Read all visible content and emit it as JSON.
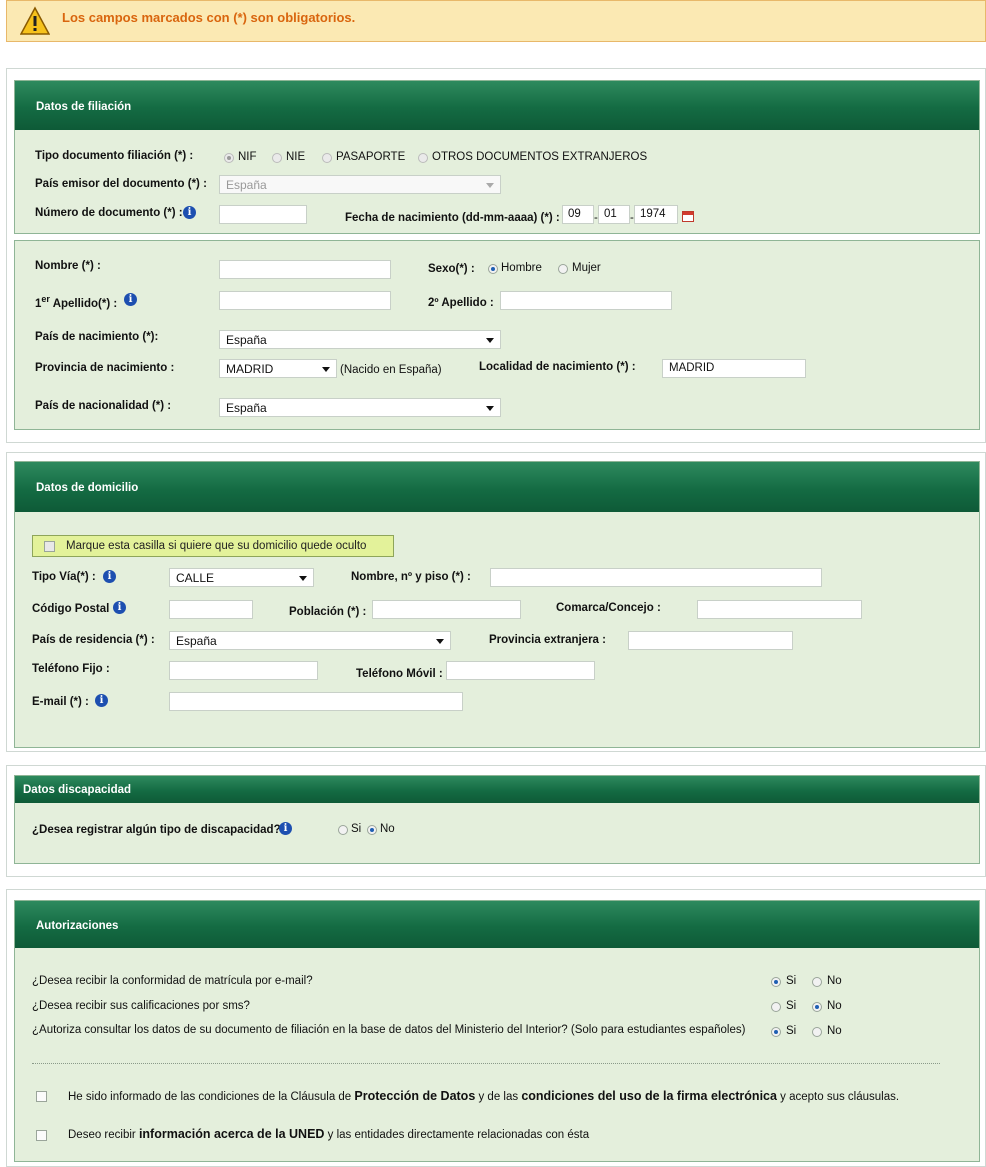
{
  "warning": {
    "text": "Los campos marcados con (*) son obligatorios.",
    "icon": "warning-icon"
  },
  "filiacion": {
    "title": "Datos de filiación",
    "tipo_label": "Tipo documento filiación (*) :",
    "tipo_options": [
      "NIF",
      "NIE",
      "PASAPORTE",
      "OTROS DOCUMENTOS EXTRANJEROS"
    ],
    "tipo_selected": "NIF",
    "pais_emisor_label": "País emisor del documento (*) :",
    "pais_emisor_value": "España",
    "numero_label": "Número de documento (*) :",
    "numero_value": "",
    "fecha_label": "Fecha de nacimiento (dd-mm-aaaa) (*) :",
    "fecha_dd": "09",
    "fecha_mm": "01",
    "fecha_aaaa": "1974",
    "fecha_sep": "-"
  },
  "personal": {
    "nombre_label": "Nombre (*) :",
    "nombre_value": "",
    "sexo_label": "Sexo(*) :",
    "sexo_options": [
      "Hombre",
      "Mujer"
    ],
    "sexo_selected": "Hombre",
    "ap1_label_pre": "1",
    "ap1_label_sup": "er",
    "ap1_label_post": " Apellido(*) :",
    "ap1_value": "",
    "ap2_label": "2º Apellido :",
    "ap2_value": "",
    "pais_nac_label": "País de nacimiento (*):",
    "pais_nac_value": "España",
    "prov_nac_label": "Provincia de nacimiento :",
    "prov_nac_value": "MADRID",
    "prov_nac_note": "(Nacido en España)",
    "loc_nac_label": "Localidad de nacimiento (*) :",
    "loc_nac_value": "MADRID",
    "nacionalidad_label": "País de nacionalidad (*) :",
    "nacionalidad_value": "España"
  },
  "domicilio": {
    "title": "Datos de domicilio",
    "ocultar_label": "Marque esta casilla si quiere que su domicilio quede oculto",
    "tipo_via_label": "Tipo Vía(*) :",
    "tipo_via_value": "CALLE",
    "nombre_piso_label": "Nombre, nº y piso (*) :",
    "cp_label": "Código Postal",
    "poblacion_label": "Población (*) :",
    "comarca_label": "Comarca/Concejo :",
    "pais_res_label": "País de residencia (*) :",
    "pais_res_value": "España",
    "prov_ext_label": "Provincia extranjera :",
    "tel_fijo_label": "Teléfono Fijo :",
    "tel_movil_label": "Teléfono Móvil :",
    "email_label": "E-mail (*) :"
  },
  "discapacidad": {
    "title": "Datos discapacidad",
    "question": "¿Desea registrar algún tipo de discapacidad?",
    "options": [
      "Si",
      "No"
    ],
    "selected": "No"
  },
  "autorizaciones": {
    "title": "Autorizaciones",
    "questions": [
      {
        "text": "¿Desea recibir la conformidad de matrícula por e-mail?",
        "selected": "Si"
      },
      {
        "text": "¿Desea recibir sus calificaciones por sms?",
        "selected": "No"
      },
      {
        "text": "¿Autoriza consultar los datos de su documento de filiación en la base de datos del Ministerio del Interior? (Solo para estudiantes españoles)",
        "selected": "Si"
      }
    ],
    "yes_label": "Si",
    "no_label": "No",
    "check1_a": "He sido informado de las condiciones de la Cláusula de ",
    "check1_b": "Protección de Datos",
    "check1_c": " y de las ",
    "check1_d": "condiciones del uso de la firma electrónica",
    "check1_e": " y acepto sus cláusulas.",
    "check2_a": "Deseo recibir ",
    "check2_b": "información acerca de la UNED",
    "check2_c": " y las entidades directamente relacionadas con ésta"
  },
  "colors": {
    "header_green": "#146b43",
    "panel_bg": "#e4efdc",
    "warning_text": "#d9650e",
    "warning_bg": "#fbe9b3"
  }
}
